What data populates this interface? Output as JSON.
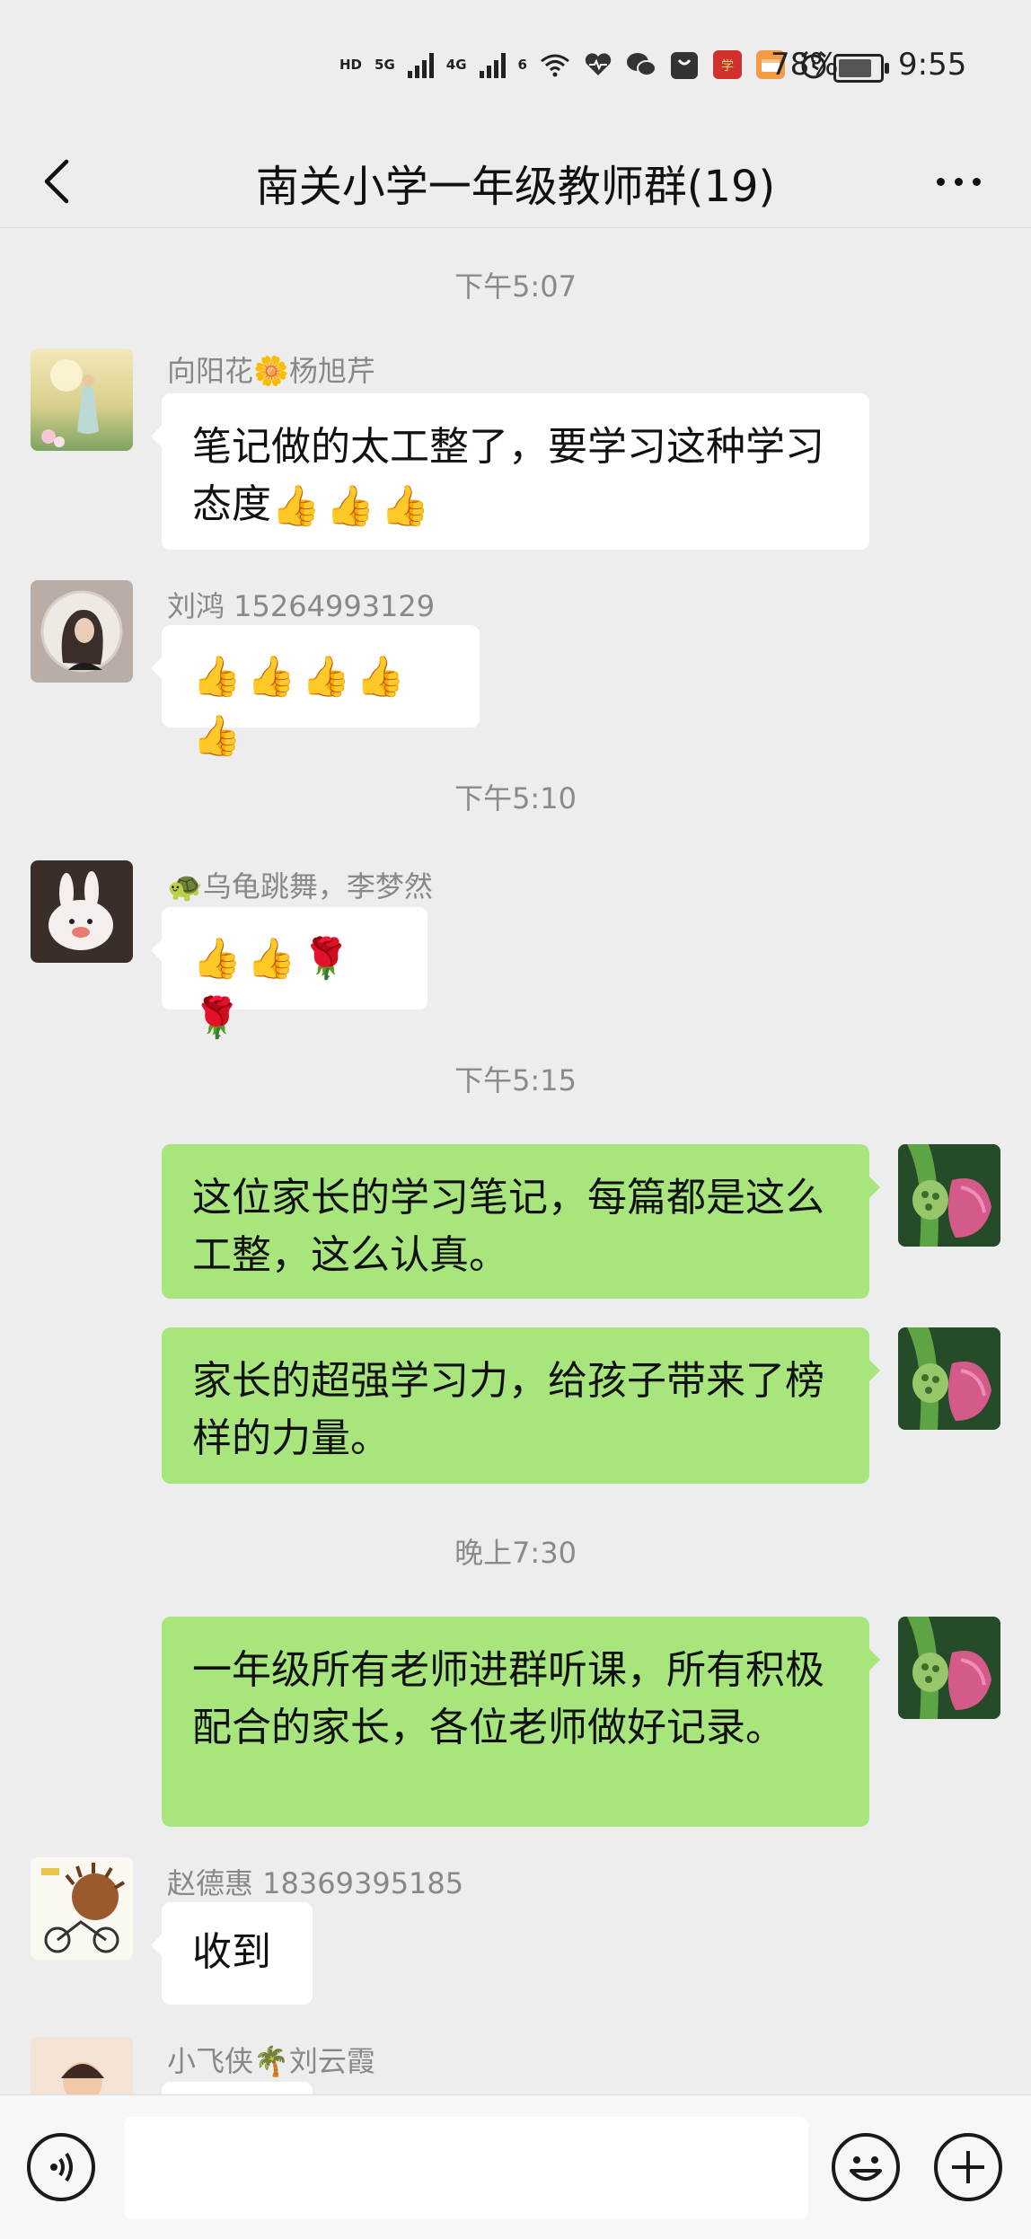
{
  "status_bar": {
    "network_tags": [
      "HD",
      "5G",
      "4G",
      "6"
    ],
    "battery_percent": "78%",
    "time": "9:55",
    "icons": [
      "signal-5g-icon",
      "signal-4g-icon",
      "wifi-icon",
      "health-heart-icon",
      "wechat-icon",
      "shopping-bag-icon",
      "study-app-icon",
      "wallet-icon",
      "alarm-icon",
      "battery-icon"
    ]
  },
  "header": {
    "back_icon": "back-chevron-icon",
    "title": "南关小学一年级教师群(19)",
    "more_icon": "more-dots-icon"
  },
  "messages": [
    {
      "type": "time",
      "text": "下午5:07"
    },
    {
      "type": "in",
      "sender": "向阳花🌼杨旭芹",
      "text": "笔记做的太工整了，要学习这种学习态度",
      "emojis": [
        "👍",
        "👍",
        "👍"
      ]
    },
    {
      "type": "in",
      "sender": "刘鸿 15264993129",
      "text": "",
      "emojis": [
        "👍",
        "👍",
        "👍",
        "👍",
        "👍"
      ]
    },
    {
      "type": "time",
      "text": "下午5:10"
    },
    {
      "type": "in",
      "sender": "🐢乌龟跳舞，李梦然",
      "text": "",
      "emojis": [
        "👍",
        "👍",
        "🌹",
        "🌹"
      ]
    },
    {
      "type": "time",
      "text": "下午5:15"
    },
    {
      "type": "out",
      "text": "这位家长的学习笔记，每篇都是这么工整，这么认真。"
    },
    {
      "type": "out",
      "text": "家长的超强学习力，给孩子带来了榜样的力量。"
    },
    {
      "type": "time",
      "text": "晚上7:30"
    },
    {
      "type": "out",
      "text": "一年级所有老师进群听课，所有积极配合的家长，各位老师做好记录。"
    },
    {
      "type": "in",
      "sender": "赵德惠 18369395185",
      "text": "收到"
    },
    {
      "type": "in",
      "sender": "小飞侠🌴刘云霞",
      "text": ""
    }
  ],
  "input_bar": {
    "voice_icon": "voice-input-icon",
    "emoji_icon": "emoji-icon",
    "plus_icon": "plus-icon",
    "placeholder": ""
  },
  "colors": {
    "background": "#ededed",
    "bubble_out": "#a8e67d",
    "bubble_in": "#ffffff",
    "meta_text": "#888888"
  }
}
